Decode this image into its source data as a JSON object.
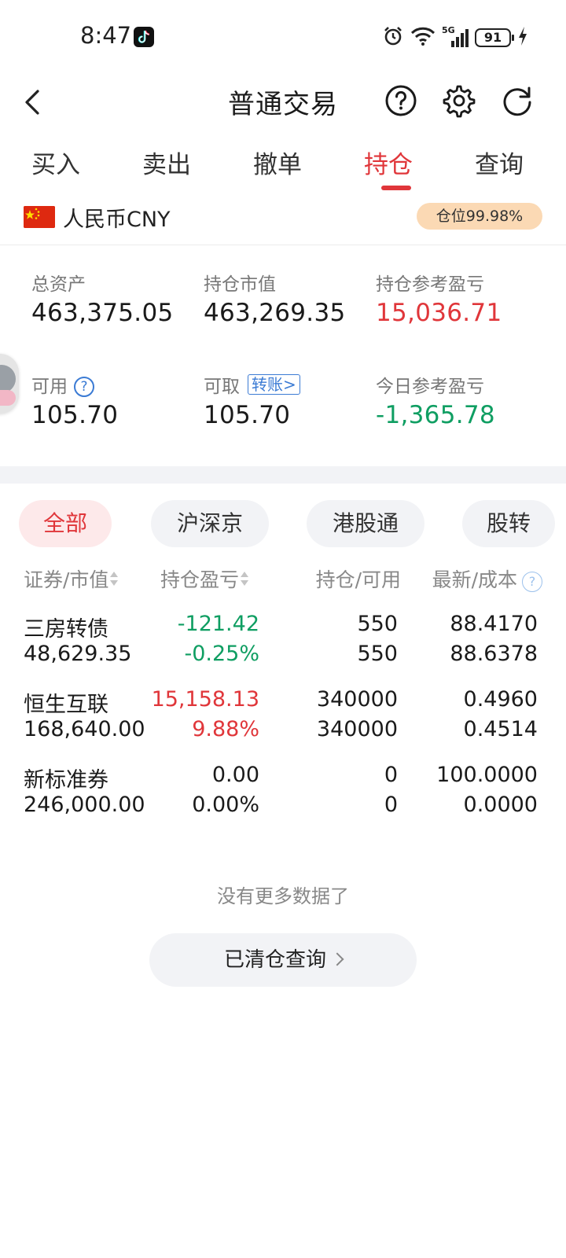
{
  "status_bar": {
    "time": "8:47",
    "network": "5G",
    "battery": "91"
  },
  "header": {
    "title": "普通交易"
  },
  "tabs": [
    {
      "label": "买入"
    },
    {
      "label": "卖出"
    },
    {
      "label": "撤单"
    },
    {
      "label": "持仓",
      "active": true
    },
    {
      "label": "查询"
    }
  ],
  "currency": {
    "label": "人民币CNY",
    "position_badge": "仓位99.98%"
  },
  "summary": {
    "total_assets_label": "总资产",
    "total_assets": "463,375.05",
    "market_value_label": "持仓市值",
    "market_value": "463,269.35",
    "position_pl_label": "持仓参考盈亏",
    "position_pl": "15,036.71",
    "available_label": "可用",
    "available": "105.70",
    "withdrawable_label": "可取",
    "transfer_link": "转账>",
    "withdrawable": "105.70",
    "today_pl_label": "今日参考盈亏",
    "today_pl": "-1,365.78"
  },
  "filters": [
    {
      "label": "全部",
      "active": true
    },
    {
      "label": "沪深京"
    },
    {
      "label": "港股通"
    },
    {
      "label": "股转"
    }
  ],
  "table": {
    "headers": {
      "security": "证券/市值",
      "pl": "持仓盈亏",
      "qty": "持仓/可用",
      "price": "最新/成本"
    },
    "rows": [
      {
        "name": "三房转债",
        "market_value": "48,629.35",
        "pl": "-121.42",
        "pl_pct": "-0.25%",
        "qty": "550",
        "available": "550",
        "latest": "88.4170",
        "cost": "88.6378"
      },
      {
        "name": "恒生互联",
        "market_value": "168,640.00",
        "pl": "15,158.13",
        "pl_pct": "9.88%",
        "qty": "340000",
        "available": "340000",
        "latest": "0.4960",
        "cost": "0.4514"
      },
      {
        "name": "新标准券",
        "market_value": "246,000.00",
        "pl": "0.00",
        "pl_pct": "0.00%",
        "qty": "0",
        "available": "0",
        "latest": "100.0000",
        "cost": "0.0000"
      }
    ]
  },
  "footer": {
    "no_more": "没有更多数据了",
    "cleared_query": "已清仓查询"
  },
  "colors": {
    "accent_red": "#e0363a",
    "gain_red": "#e0363a",
    "loss_green": "#0f9e62",
    "badge_bg": "#fbd9b4",
    "link_blue": "#3b7bd4"
  }
}
